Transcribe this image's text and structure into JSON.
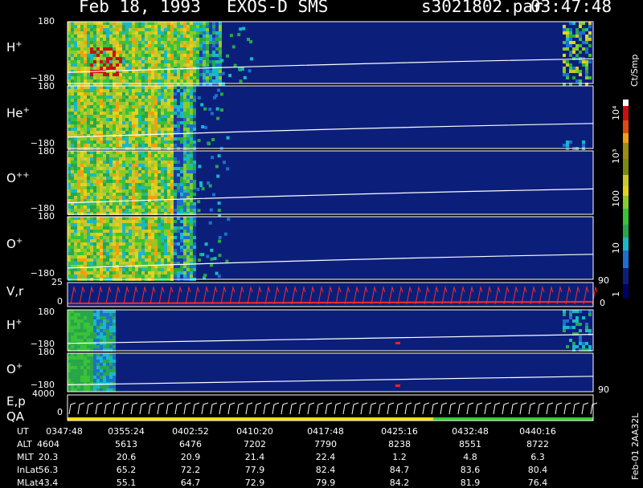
{
  "header": {
    "date": "Feb 18, 1993",
    "instrument": "EXOS-D SMS",
    "file": "s3021802.par",
    "time": "03:47:48"
  },
  "colors": {
    "background": "#0b1f7a",
    "trace": "#ffffff",
    "vr_trace": "#ff2a2a",
    "qa_yellow": "#f0e000",
    "qa_green": "#33cc33"
  },
  "panels": [
    {
      "id": "h-plus",
      "ion": "H",
      "charge": "+",
      "ymax": "180",
      "ymin": "−180"
    },
    {
      "id": "he-plus",
      "ion": "He",
      "charge": "+",
      "ymax": "180",
      "ymin": "−180"
    },
    {
      "id": "o-plusplus",
      "ion": "O",
      "charge": "++",
      "ymax": "180",
      "ymin": "−180"
    },
    {
      "id": "o-plus",
      "ion": "O",
      "charge": "+",
      "ymax": "180",
      "ymin": "−180"
    },
    {
      "id": "vr",
      "label": "V,r",
      "ymax": "25",
      "ymin": "0",
      "right_max": "90",
      "right_min": "0"
    },
    {
      "id": "h-plus-2",
      "ion": "H",
      "charge": "+",
      "ymax": "180",
      "ymin": "−180"
    },
    {
      "id": "o-plus-2",
      "ion": "O",
      "charge": "+",
      "ymax": "180",
      "ymin": "−180",
      "right_max": "90"
    },
    {
      "id": "ep",
      "label": "E,p",
      "label2": "QA",
      "ymax": "4000",
      "ymin": "0"
    }
  ],
  "colorbar": {
    "unit": "Ct/Smp",
    "ticks": [
      "10⁴",
      "10³",
      "100",
      "10",
      "1"
    ]
  },
  "chart_data": {
    "type": "heatmap",
    "title": "Feb 18, 1993   EXOS-D SMS",
    "x_ticks": [
      "0347:48",
      "0355:24",
      "0402:52",
      "0410:20",
      "0417:48",
      "0425:16",
      "0432:48",
      "0440:16"
    ],
    "rows": [
      {
        "name": "UT",
        "values": [
          "0347:48",
          "0355:24",
          "0402:52",
          "0410:20",
          "0417:48",
          "0425:16",
          "0432:48",
          "0440:16"
        ]
      },
      {
        "name": "ALT",
        "values": [
          "4604",
          "5613",
          "6476",
          "7202",
          "7790",
          "8238",
          "8551",
          "8722"
        ]
      },
      {
        "name": "MLT",
        "values": [
          "20.3",
          "20.6",
          "20.9",
          "21.4",
          "22.4",
          "1.2",
          "4.8",
          "6.3"
        ]
      },
      {
        "name": "InLat",
        "values": [
          "56.3",
          "65.2",
          "72.2",
          "77.9",
          "82.4",
          "84.7",
          "83.6",
          "80.4"
        ]
      },
      {
        "name": "MLat",
        "values": [
          "43.4",
          "55.1",
          "64.7",
          "72.9",
          "79.9",
          "84.2",
          "81.9",
          "76.4"
        ]
      }
    ],
    "side_label": "Feb-01 2AA32L"
  }
}
